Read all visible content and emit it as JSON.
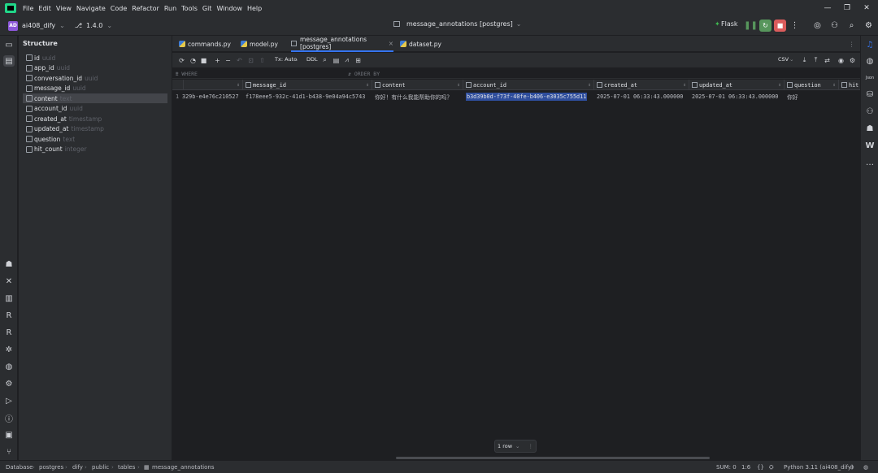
{
  "menu": [
    "File",
    "Edit",
    "View",
    "Navigate",
    "Code",
    "Refactor",
    "Run",
    "Tools",
    "Git",
    "Window",
    "Help"
  ],
  "window_controls": {
    "minimize": "—",
    "maximize": "❐",
    "close": "✕"
  },
  "toolbar": {
    "project_badge": "AD",
    "project_name": "ai408_dify",
    "branch": "1.4.0",
    "title": "message_annotations [postgres]",
    "run_config": "Flask"
  },
  "structure": {
    "title": "Structure",
    "items": [
      {
        "name": "id",
        "type": "uuid"
      },
      {
        "name": "app_id",
        "type": "uuid"
      },
      {
        "name": "conversation_id",
        "type": "uuid"
      },
      {
        "name": "message_id",
        "type": "uuid"
      },
      {
        "name": "content",
        "type": "text"
      },
      {
        "name": "account_id",
        "type": "uuid"
      },
      {
        "name": "created_at",
        "type": "timestamp"
      },
      {
        "name": "updated_at",
        "type": "timestamp"
      },
      {
        "name": "question",
        "type": "text"
      },
      {
        "name": "hit_count",
        "type": "integer"
      }
    ]
  },
  "tabs": [
    "commands.py",
    "model.py",
    "message_annotations [postgres]",
    "dataset.py"
  ],
  "grid_toolbar": {
    "tx": "Tx: Auto",
    "ddl": "DDL",
    "export": "CSV"
  },
  "filter": {
    "where": "WHERE",
    "order_by": "ORDER BY"
  },
  "table": {
    "columns": [
      "message_id",
      "content",
      "account_id",
      "created_at",
      "updated_at",
      "question",
      "hit"
    ],
    "rows": [
      {
        "num": "1",
        "id": "329b-e4e76c210527",
        "message_id": "f178eee5-932c-41d1-b438-9e04a94c5743",
        "content": "你好！有什么我能帮助你的吗？",
        "account_id": "b3d39b0d-f73f-40fe-b406-e3035c755d11",
        "created_at": "2025-07-01 06:33:43.000000",
        "updated_at": "2025-07-01 06:33:43.000000",
        "question": "你好"
      }
    ],
    "row_count": "1 row"
  },
  "statusbar": {
    "breadcrumb": [
      "Database",
      "postgres",
      "dify",
      "public",
      "tables",
      "message_annotations"
    ],
    "sum": "SUM: 0",
    "position": "1:6",
    "braces": "{}",
    "interpreter": "Python 3.11 (ai408_dify)"
  }
}
